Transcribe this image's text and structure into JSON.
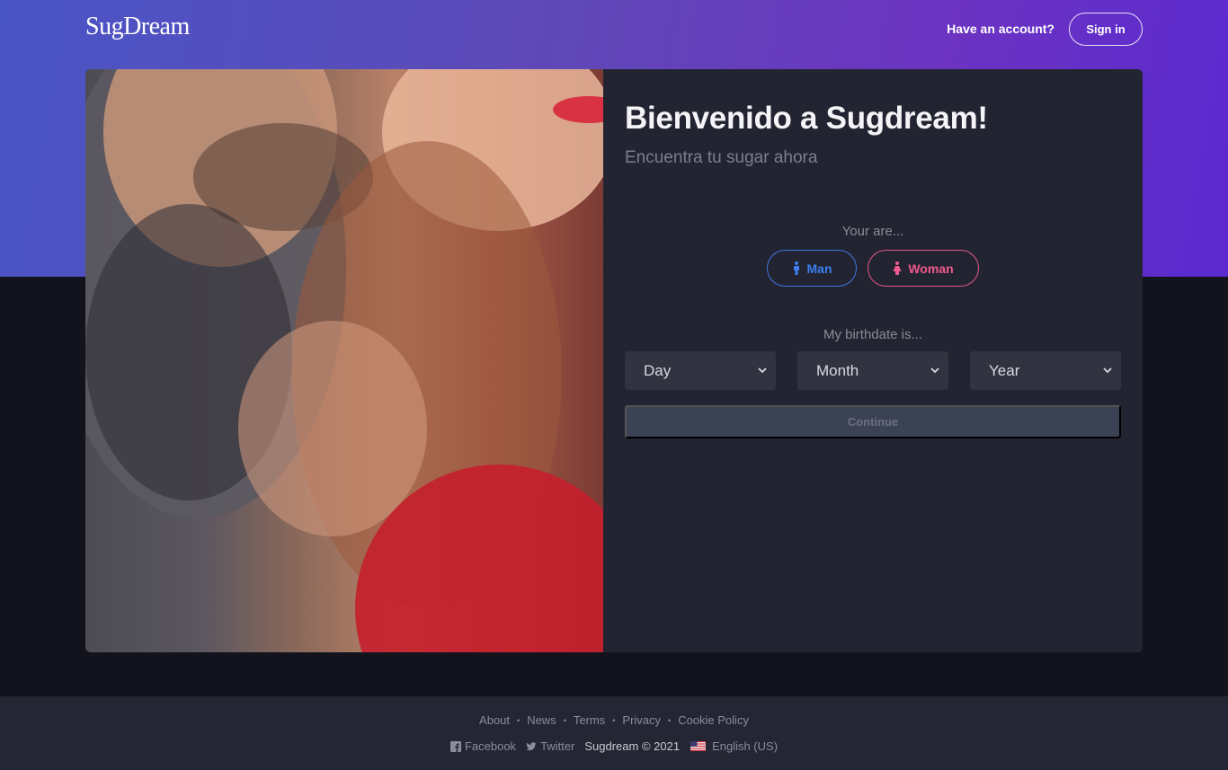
{
  "header": {
    "logo": "SugDream",
    "account_prompt": "Have an account?",
    "signin_label": "Sign in"
  },
  "form": {
    "title": "Bienvenido a Sugdream!",
    "subtitle": "Encuentra tu sugar ahora",
    "gender_prompt": "Your are...",
    "gender_options": [
      {
        "label": "Man",
        "color": "#3c7ef0",
        "icon": "male-icon"
      },
      {
        "label": "Woman",
        "color": "#f05a8e",
        "icon": "female-icon"
      }
    ],
    "birthdate_prompt": "My birthdate is...",
    "selects": {
      "day": "Day",
      "month": "Month",
      "year": "Year"
    },
    "continue_label": "Continue"
  },
  "footer": {
    "links": [
      "About",
      "News",
      "Terms",
      "Privacy",
      "Cookie Policy"
    ],
    "social": [
      {
        "label": "Facebook",
        "icon": "facebook-icon"
      },
      {
        "label": "Twitter",
        "icon": "twitter-icon"
      }
    ],
    "copyright": "Sugdream © 2021",
    "language": "English (US)",
    "language_icon": "us-flag-icon"
  },
  "colors": {
    "hero_gradient_start": "#4a55c6",
    "hero_gradient_end": "#5a2ad0",
    "page_bg": "#12131d",
    "card_bg": "#232431",
    "footer_bg": "#252633",
    "man_accent": "#3c7ef0",
    "woman_accent": "#f05a8e"
  }
}
